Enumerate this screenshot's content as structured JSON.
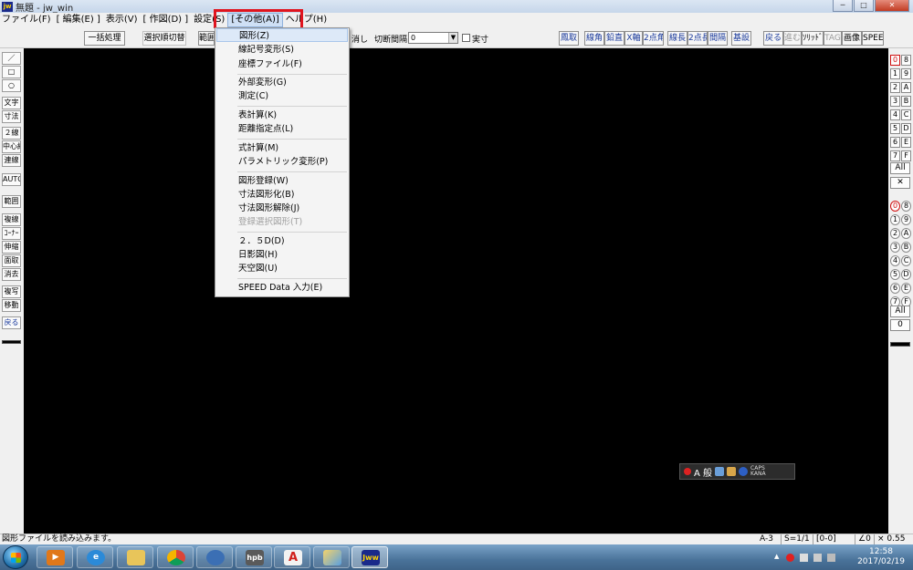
{
  "window": {
    "title": "無題 - jw_win",
    "app_icon_label": "jw"
  },
  "menubar": {
    "items": [
      "ファイル(F)",
      "[ 編集(E) ]",
      "表示(V)",
      "[ 作図(D) ]",
      "設定(S)",
      "[その他(A)]",
      "ヘルプ(H)"
    ]
  },
  "toolbar": {
    "batch": "一括処理",
    "select_toggle": "選択順切替",
    "range": "範囲",
    "erase_text": "消し",
    "cut_interval_label": "切断間隔",
    "cut_interval_value": "0",
    "actual_size_label": "実寸",
    "right_buttons": [
      "鳳取",
      "線角",
      "鉛直",
      "X軸",
      "2点角",
      "線長",
      "2点長",
      "間隔",
      "基設"
    ],
    "right_buttons2": [
      "戻る",
      "進む",
      "ｿﾘｯﾄﾞ",
      "TAG",
      "画像",
      "SPEED"
    ]
  },
  "left_tools": [
    "／",
    "□",
    "○",
    "文字",
    "寸法",
    "２線",
    "中心線",
    "連線",
    "AUTO",
    "範囲",
    "複線",
    "ｺｰﾅｰ",
    "伸縮",
    "面取",
    "消去",
    "複写",
    "移動",
    "戻る"
  ],
  "right_layers": {
    "groups_left": [
      "0",
      "1",
      "2",
      "3",
      "4",
      "5",
      "6",
      "7"
    ],
    "groups_right": [
      "8",
      "9",
      "A",
      "B",
      "C",
      "D",
      "E",
      "F"
    ],
    "all_label": "All",
    "cross_label": "✕",
    "layers_left": [
      "0",
      "1",
      "2",
      "3",
      "4",
      "5",
      "6",
      "7"
    ],
    "layers_right": [
      "8",
      "9",
      "A",
      "B",
      "C",
      "D",
      "E",
      "F"
    ],
    "all_label2": "All",
    "zero_label": "0"
  },
  "dropdown": {
    "items": [
      {
        "label": "図形(Z)"
      },
      {
        "label": "線記号変形(S)"
      },
      {
        "label": "座標ファイル(F)"
      },
      {
        "label": "外部変形(G)"
      },
      {
        "label": "測定(C)"
      },
      {
        "label": "表計算(K)"
      },
      {
        "label": "距離指定点(L)"
      },
      {
        "label": "式計算(M)"
      },
      {
        "label": "パラメトリック変形(P)"
      },
      {
        "label": "図形登録(W)"
      },
      {
        "label": "寸法図形化(B)"
      },
      {
        "label": "寸法図形解除(J)"
      },
      {
        "label": "登録選択図形(T)"
      },
      {
        "label": "２．５D(D)"
      },
      {
        "label": "日影図(H)"
      },
      {
        "label": "天空図(U)"
      },
      {
        "label": "SPEED Data 入力(E)"
      }
    ]
  },
  "ime": {
    "mode_label": "A 般",
    "caps": "CAPS",
    "kana": "KANA"
  },
  "status": {
    "message": "図形ファイルを読み込みます。",
    "paper": "A-3",
    "scale": "S=1/1",
    "layer": "[0-0]",
    "angle": "∠0",
    "zoom": "× 0.55"
  },
  "taskbar": {
    "apps": [
      "media-player",
      "internet-explorer",
      "file-explorer",
      "chrome",
      "thunderbird",
      "hpb",
      "acrobat",
      "paint",
      "jw_win"
    ],
    "hpb_label": "hpb",
    "jw_label": "Jww",
    "time": "12:58",
    "date": "2017/02/19"
  }
}
